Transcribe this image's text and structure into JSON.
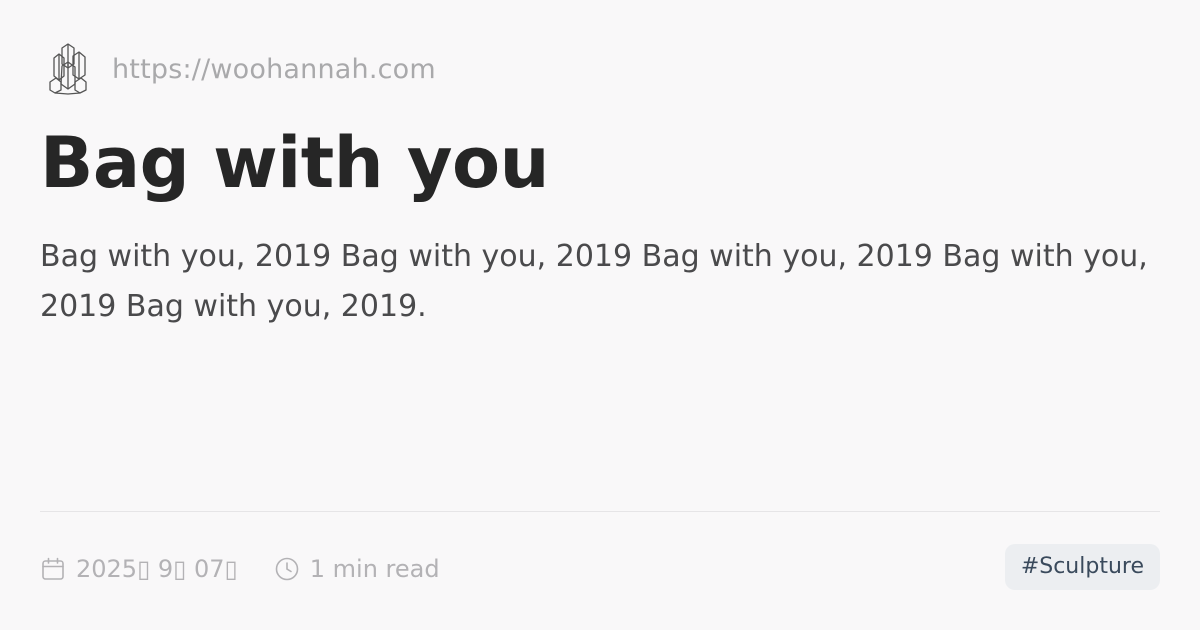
{
  "site": {
    "url": "https://woohannah.com",
    "logo_icon": "crystal-logo-icon"
  },
  "post": {
    "title": "Bag with you",
    "description": "Bag with you, 2019 Bag with you, 2019 Bag with you, 2019 Bag with you, 2019 Bag with you, 2019."
  },
  "meta": {
    "date": "2025▯ 9▯ 07▯",
    "date_icon": "calendar-icon",
    "read_time": "1 min read",
    "read_time_icon": "clock-icon"
  },
  "tags": [
    "#Sculpture"
  ],
  "colors": {
    "background": "#f9f8f9",
    "title": "#262626",
    "tag_background": "#eceef1",
    "tag_text": "#3a4a5c"
  }
}
